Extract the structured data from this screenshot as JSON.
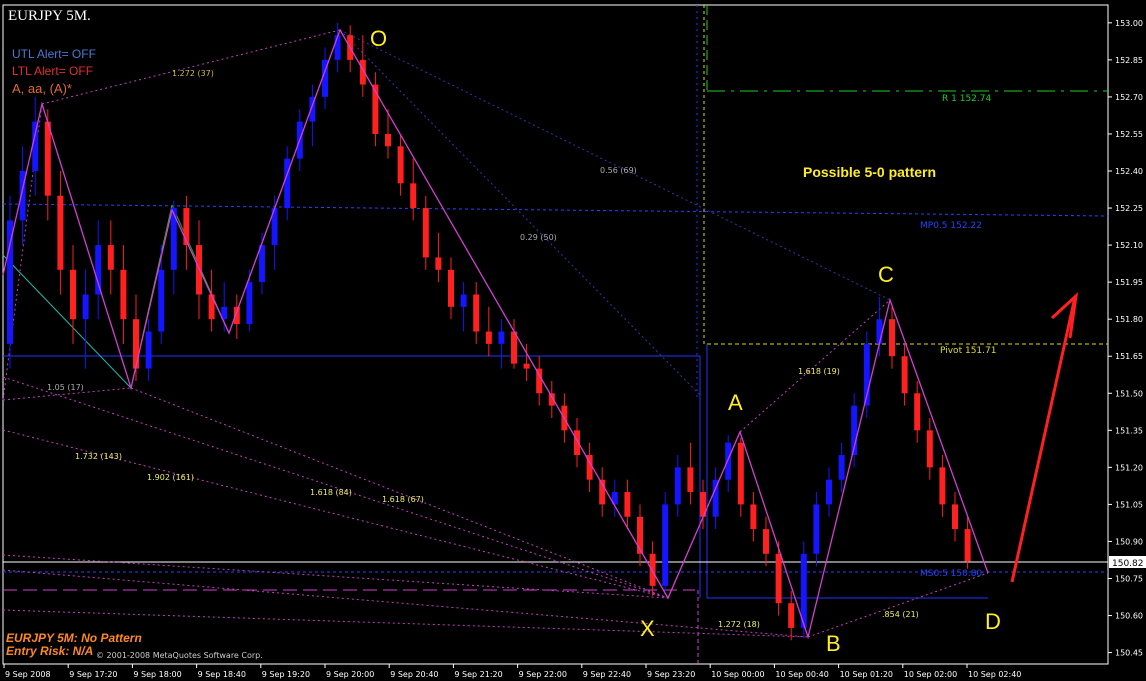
{
  "window": {
    "title": "EURJPY 5M.",
    "status_lines": [
      "UTL Alert= OFF",
      "LTL Alert= OFF",
      "A, aa, (A)*"
    ],
    "pattern_status": "EURJPY 5M: No Pattern",
    "entry_risk": "Entry Risk: N/A",
    "copyright": "© 2001-2008 MetaQuotes Software Corp.",
    "annotation": "Possible 5-0 pattern",
    "colors": {
      "bull_candle": "#1515ff",
      "bear_candle": "#ff2020",
      "pattern_line": "#d040d0",
      "point_label": "#ffee22",
      "r1": "#22cc22",
      "pivot": "#dddd22",
      "mp": "#2244ff",
      "arrow": "#ff2020"
    }
  },
  "chart_data": {
    "type": "line",
    "ylim": [
      150.42,
      153.06
    ],
    "price_axis_ticks": [
      "153.00",
      "152.85",
      "152.70",
      "152.55",
      "152.40",
      "152.25",
      "152.10",
      "151.95",
      "151.80",
      "151.65",
      "151.50",
      "151.35",
      "151.20",
      "151.05",
      "150.90",
      "150.75",
      "150.60",
      "150.45"
    ],
    "current_price": "150.82",
    "time_axis_ticks": [
      "9 Sep 2008",
      "9 Sep 17:20",
      "9 Sep 18:00",
      "9 Sep 18:40",
      "9 Sep 19:20",
      "9 Sep 20:00",
      "9 Sep 20:40",
      "9 Sep 21:20",
      "9 Sep 22:00",
      "9 Sep 22:40",
      "9 Sep 23:20",
      "10 Sep 00:00",
      "10 Sep 00:40",
      "10 Sep 01:20",
      "10 Sep 02:00",
      "10 Sep 02:40"
    ],
    "pattern_points": [
      {
        "label": "O",
        "time_index": 26.5,
        "price": 152.99
      },
      {
        "label": "X",
        "time_index": 51.9,
        "price": 150.68
      },
      {
        "label": "A",
        "time_index": 57.5,
        "price": 151.33
      },
      {
        "label": "B",
        "time_index": 63.0,
        "price": 150.51
      },
      {
        "label": "C",
        "time_index": 69.0,
        "price": 151.89
      },
      {
        "label": "D",
        "time_index": 76.2,
        "price": 150.79
      }
    ],
    "levels": [
      {
        "name": "R 1",
        "value": "152.74"
      },
      {
        "name": "MP0.5",
        "value": "152.22"
      },
      {
        "name": "Pivot",
        "value": "151.71"
      },
      {
        "name": "MS0.5",
        "value": "150.80"
      }
    ],
    "ratio_labels": [
      "1.272 (37)",
      "0.56 (69)",
      "0.29 (50)",
      "1.05 (17)",
      "1.732 (143)",
      "1.902 (161)",
      "1.618 (84)",
      "1.618 (67)",
      "1.618 (19)",
      "1.272 (18)",
      ".854 (21)"
    ],
    "candles": [
      [
        151.7,
        152.3,
        151.6,
        152.2
      ],
      [
        152.2,
        152.5,
        152.1,
        152.4
      ],
      [
        152.4,
        152.7,
        152.3,
        152.6
      ],
      [
        152.6,
        152.65,
        152.2,
        152.3
      ],
      [
        152.3,
        152.4,
        151.9,
        152.0
      ],
      [
        152.0,
        152.1,
        151.7,
        151.8
      ],
      [
        151.8,
        152.0,
        151.6,
        151.9
      ],
      [
        151.9,
        152.2,
        151.8,
        152.1
      ],
      [
        152.1,
        152.2,
        151.9,
        152.0
      ],
      [
        152.0,
        152.1,
        151.7,
        151.8
      ],
      [
        151.8,
        151.9,
        151.55,
        151.6
      ],
      [
        151.6,
        151.8,
        151.55,
        151.75
      ],
      [
        151.75,
        152.1,
        151.7,
        152.0
      ],
      [
        152.0,
        152.28,
        151.9,
        152.25
      ],
      [
        152.25,
        152.3,
        152.0,
        152.1
      ],
      [
        152.1,
        152.2,
        151.8,
        151.9
      ],
      [
        151.9,
        152.0,
        151.75,
        151.8
      ],
      [
        151.8,
        151.95,
        151.75,
        151.85
      ],
      [
        151.85,
        151.9,
        151.72,
        151.78
      ],
      [
        151.78,
        152.0,
        151.75,
        151.95
      ],
      [
        151.95,
        152.15,
        151.9,
        152.1
      ],
      [
        152.1,
        152.3,
        152.0,
        152.25
      ],
      [
        152.25,
        152.5,
        152.2,
        152.45
      ],
      [
        152.45,
        152.65,
        152.4,
        152.6
      ],
      [
        152.6,
        152.75,
        152.5,
        152.7
      ],
      [
        152.7,
        152.9,
        152.65,
        152.85
      ],
      [
        152.85,
        153.0,
        152.8,
        152.95
      ],
      [
        152.95,
        152.99,
        152.8,
        152.85
      ],
      [
        152.85,
        152.95,
        152.7,
        152.75
      ],
      [
        152.75,
        152.8,
        152.5,
        152.55
      ],
      [
        152.55,
        152.65,
        152.45,
        152.5
      ],
      [
        152.5,
        152.55,
        152.3,
        152.35
      ],
      [
        152.35,
        152.45,
        152.2,
        152.25
      ],
      [
        152.25,
        152.3,
        152.0,
        152.05
      ],
      [
        152.05,
        152.15,
        151.95,
        152.0
      ],
      [
        152.0,
        152.05,
        151.8,
        151.85
      ],
      [
        151.85,
        151.95,
        151.75,
        151.9
      ],
      [
        151.9,
        151.95,
        151.7,
        151.75
      ],
      [
        151.75,
        151.85,
        151.65,
        151.7
      ],
      [
        151.7,
        151.8,
        151.6,
        151.75
      ],
      [
        151.75,
        151.8,
        151.6,
        151.62
      ],
      [
        151.62,
        151.7,
        151.55,
        151.6
      ],
      [
        151.6,
        151.65,
        151.45,
        151.5
      ],
      [
        151.5,
        151.55,
        151.4,
        151.45
      ],
      [
        151.45,
        151.5,
        151.3,
        151.35
      ],
      [
        151.35,
        151.4,
        151.2,
        151.25
      ],
      [
        151.25,
        151.3,
        151.1,
        151.15
      ],
      [
        151.15,
        151.2,
        151.0,
        151.05
      ],
      [
        151.05,
        151.15,
        151.0,
        151.1
      ],
      [
        151.1,
        151.15,
        150.95,
        151.0
      ],
      [
        151.0,
        151.05,
        150.8,
        150.85
      ],
      [
        150.85,
        150.9,
        150.68,
        150.72
      ],
      [
        150.72,
        151.1,
        150.7,
        151.05
      ],
      [
        151.05,
        151.25,
        151.0,
        151.2
      ],
      [
        151.2,
        151.3,
        151.05,
        151.1
      ],
      [
        151.1,
        151.15,
        150.95,
        151.0
      ],
      [
        151.0,
        151.2,
        150.95,
        151.15
      ],
      [
        151.15,
        151.33,
        151.1,
        151.3
      ],
      [
        151.3,
        151.32,
        151.0,
        151.05
      ],
      [
        151.05,
        151.1,
        150.9,
        150.95
      ],
      [
        150.95,
        151.0,
        150.8,
        150.85
      ],
      [
        150.85,
        150.9,
        150.6,
        150.65
      ],
      [
        150.65,
        150.7,
        150.5,
        150.55
      ],
      [
        150.55,
        150.9,
        150.51,
        150.85
      ],
      [
        150.85,
        151.1,
        150.8,
        151.05
      ],
      [
        151.05,
        151.2,
        151.0,
        151.15
      ],
      [
        151.15,
        151.3,
        151.1,
        151.25
      ],
      [
        151.25,
        151.5,
        151.2,
        151.45
      ],
      [
        151.45,
        151.75,
        151.4,
        151.7
      ],
      [
        151.7,
        151.89,
        151.65,
        151.8
      ],
      [
        151.8,
        151.85,
        151.6,
        151.65
      ],
      [
        151.65,
        151.7,
        151.45,
        151.5
      ],
      [
        151.5,
        151.55,
        151.3,
        151.35
      ],
      [
        151.35,
        151.4,
        151.15,
        151.2
      ],
      [
        151.2,
        151.25,
        151.0,
        151.05
      ],
      [
        151.05,
        151.1,
        150.9,
        150.95
      ],
      [
        150.95,
        151.0,
        150.79,
        150.82
      ]
    ]
  }
}
